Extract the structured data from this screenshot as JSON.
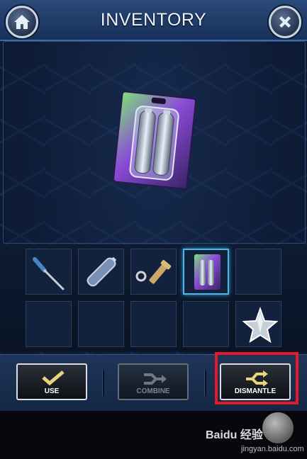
{
  "header": {
    "title": "INVENTORY",
    "home_icon": "home-icon",
    "close_icon": "close-icon"
  },
  "selected_item": {
    "icon": "battery-pack-icon"
  },
  "inventory": {
    "slots": [
      {
        "icon": "screwdriver-icon",
        "selected": false
      },
      {
        "icon": "single-battery-icon",
        "selected": false
      },
      {
        "icon": "screw-and-nut-icon",
        "selected": false
      },
      {
        "icon": "battery-pack-icon",
        "selected": true
      },
      {
        "icon": "",
        "selected": false
      },
      {
        "icon": "",
        "selected": false
      },
      {
        "icon": "",
        "selected": false
      },
      {
        "icon": "",
        "selected": false
      },
      {
        "icon": "",
        "selected": false
      },
      {
        "icon": "star-badge-icon",
        "selected": false
      }
    ]
  },
  "actions": {
    "use_label": "USE",
    "combine_label": "COMBINE",
    "dismantle_label": "DISMANTLE"
  },
  "watermark": {
    "brand": "Baidu 经验",
    "url": "jingyan.baidu.com"
  },
  "colors": {
    "accent": "#4fb7e6",
    "highlight": "#e5192a",
    "header": "#2a4a7a"
  }
}
